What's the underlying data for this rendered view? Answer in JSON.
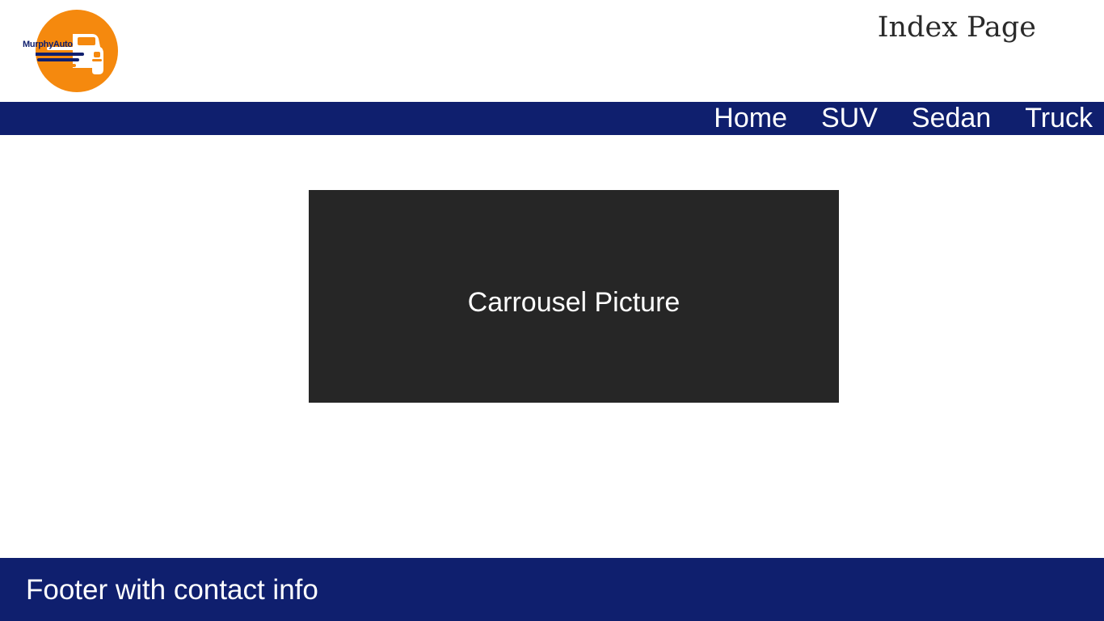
{
  "header": {
    "logo_text": "MurphyAuto",
    "page_title": "Index Page"
  },
  "navbar": {
    "items": [
      {
        "label": "Home"
      },
      {
        "label": "SUV"
      },
      {
        "label": "Sedan"
      },
      {
        "label": "Truck"
      }
    ]
  },
  "main": {
    "carousel_label": "Carrousel Picture"
  },
  "footer": {
    "text": "Footer with contact info"
  },
  "colors": {
    "brand_navy": "#0f1f6e",
    "logo_orange": "#f5890e",
    "carousel_bg": "#262626",
    "background": "#ffffff"
  },
  "icons": {
    "logo": "car-logo-icon"
  }
}
